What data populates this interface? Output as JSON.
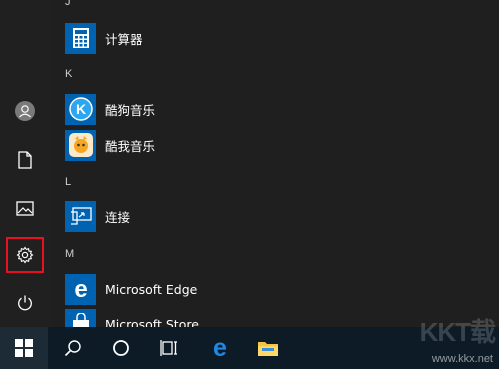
{
  "sections": {
    "j": "J",
    "k": "K",
    "l": "L",
    "m": "M"
  },
  "apps": {
    "calculator": "计算器",
    "kugou": "酷狗音乐",
    "kuwo": "酷我音乐",
    "connect": "连接",
    "edge": "Microsoft Edge",
    "store": "Microsoft Store"
  },
  "watermark": {
    "logo": "KKT载",
    "url": "www.kkx.net"
  },
  "icons": {
    "rail": [
      "user-icon",
      "document-icon",
      "pictures-icon",
      "settings-icon",
      "power-icon"
    ],
    "taskbar": [
      "windows-start-icon",
      "search-icon",
      "cortana-icon",
      "task-view-icon",
      "edge-icon",
      "file-explorer-icon"
    ]
  },
  "colors": {
    "tile_blue": "#0063b1",
    "highlight": "#e81123",
    "taskbar": "#0d1b26"
  }
}
